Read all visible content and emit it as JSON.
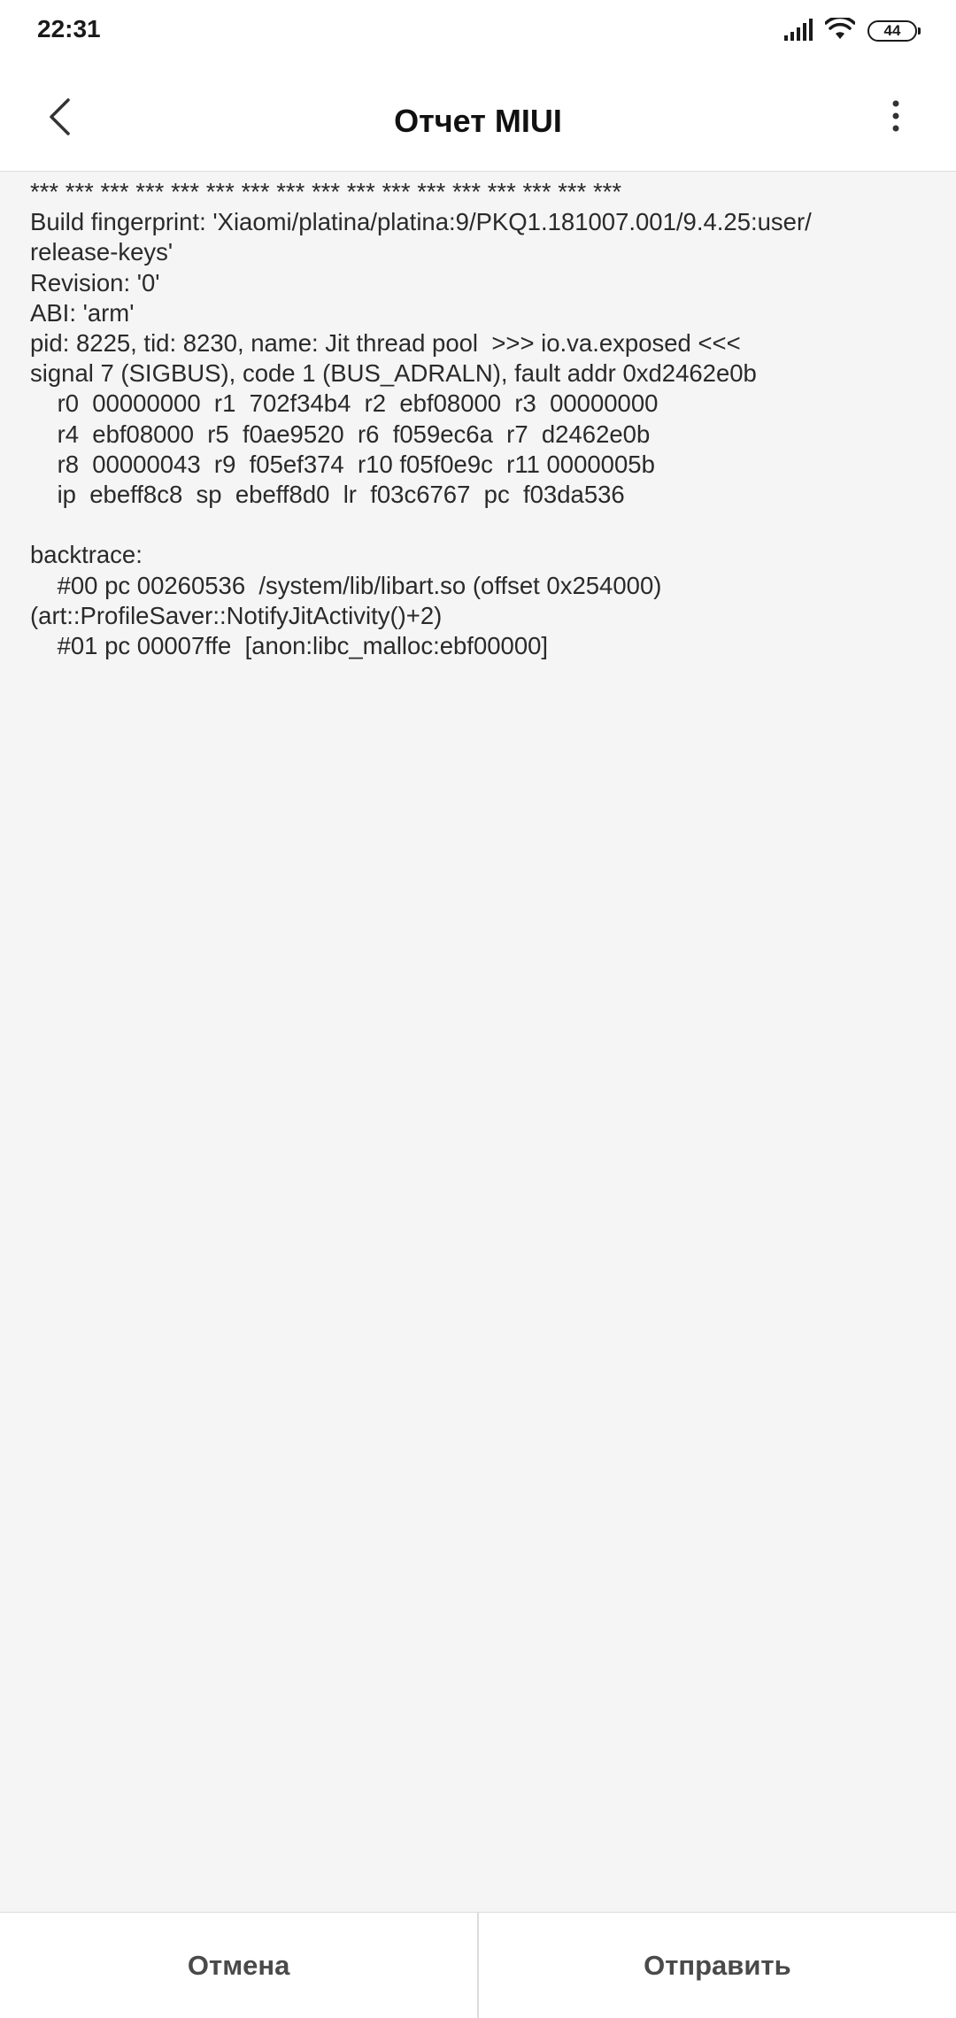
{
  "status_bar": {
    "time": "22:31",
    "battery_level": "44",
    "icons": [
      "signal-icon",
      "wifi-icon",
      "battery-icon"
    ]
  },
  "header": {
    "title": "Отчет MIUI",
    "back_icon": "chevron-left-icon",
    "more_icon": "more-vertical-icon"
  },
  "report": {
    "text": "*** *** *** *** *** *** *** *** *** *** *** *** *** *** *** *** ***\nBuild fingerprint: 'Xiaomi/platina/platina:9/PKQ1.181007.001/9.4.25:user/\nrelease-keys'\nRevision: '0'\nABI: 'arm'\npid: 8225, tid: 8230, name: Jit thread pool  >>> io.va.exposed <<<\nsignal 7 (SIGBUS), code 1 (BUS_ADRALN), fault addr 0xd2462e0b\n    r0  00000000  r1  702f34b4  r2  ebf08000  r3  00000000\n    r4  ebf08000  r5  f0ae9520  r6  f059ec6a  r7  d2462e0b\n    r8  00000043  r9  f05ef374  r10 f05f0e9c  r11 0000005b\n    ip  ebeff8c8  sp  ebeff8d0  lr  f03c6767  pc  f03da536\n\nbacktrace:\n    #00 pc 00260536  /system/lib/libart.so (offset 0x254000)\n(art::ProfileSaver::NotifyJitActivity()+2)\n    #01 pc 00007ffe  [anon:libc_malloc:ebf00000]"
  },
  "footer": {
    "cancel_label": "Отмена",
    "send_label": "Отправить"
  },
  "colors": {
    "background": "#f5f5f5",
    "bar_background": "#ffffff",
    "divider": "#dcdcdc",
    "text": "#2a2a2a",
    "button_text": "#4a4a4a"
  }
}
